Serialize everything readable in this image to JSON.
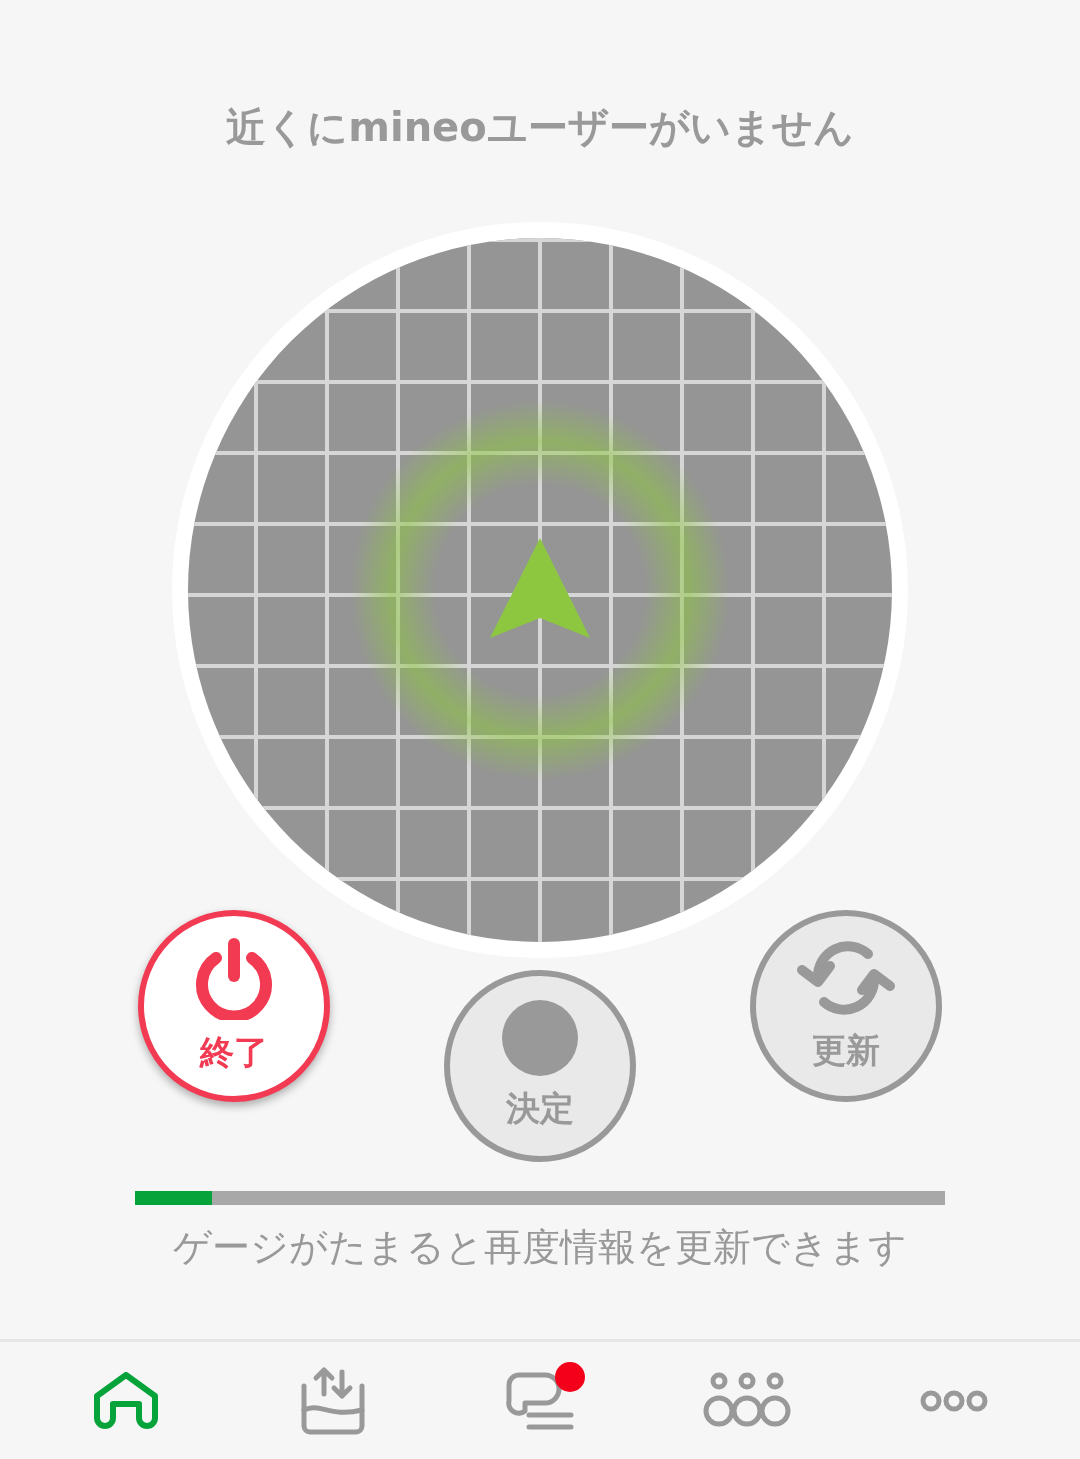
{
  "title": "近くにmineoユーザーがいません",
  "buttons": [
    {
      "label": "終了",
      "kind": "end"
    },
    {
      "label": "決定",
      "kind": "decide"
    },
    {
      "label": "更新",
      "kind": "refresh"
    }
  ],
  "gauge": {
    "level": 0.095,
    "caption": "ゲージがたまると再度情報を更新できます"
  },
  "nav": [
    {
      "kind": "home",
      "selected": true,
      "badge": false
    },
    {
      "kind": "transfer",
      "selected": false,
      "badge": false
    },
    {
      "kind": "chat",
      "selected": false,
      "badge": true
    },
    {
      "kind": "community",
      "selected": false,
      "badge": false
    },
    {
      "kind": "more",
      "selected": false,
      "badge": false
    }
  ]
}
